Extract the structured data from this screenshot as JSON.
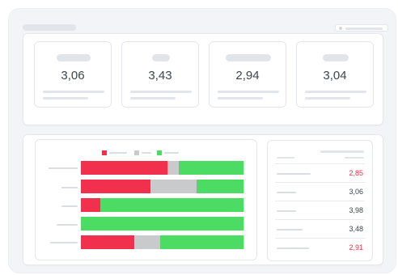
{
  "colors": {
    "red": "#f1304e",
    "gray": "#c9cacc",
    "green": "#4cdc63"
  },
  "kpis": [
    {
      "value": "3,06"
    },
    {
      "value": "3,43"
    },
    {
      "value": "2,94"
    },
    {
      "value": "3,04"
    }
  ],
  "chart_data": {
    "type": "bar",
    "orientation": "horizontal",
    "stacked": true,
    "normalized": true,
    "series": [
      {
        "color": "#f1304e",
        "values": [
          53,
          43,
          12,
          0,
          33
        ]
      },
      {
        "color": "#c9cacc",
        "values": [
          7,
          28,
          0,
          0,
          16
        ]
      },
      {
        "color": "#4cdc63",
        "values": [
          40,
          29,
          88,
          100,
          51
        ]
      }
    ],
    "legend": "top",
    "ylim": [
      0,
      100
    ]
  },
  "list": {
    "rows": [
      {
        "value": "2,85",
        "status": "bad"
      },
      {
        "value": "3,06",
        "status": "normal"
      },
      {
        "value": "3,98",
        "status": "normal"
      },
      {
        "value": "3,48",
        "status": "normal"
      },
      {
        "value": "2,91",
        "status": "bad"
      }
    ]
  }
}
